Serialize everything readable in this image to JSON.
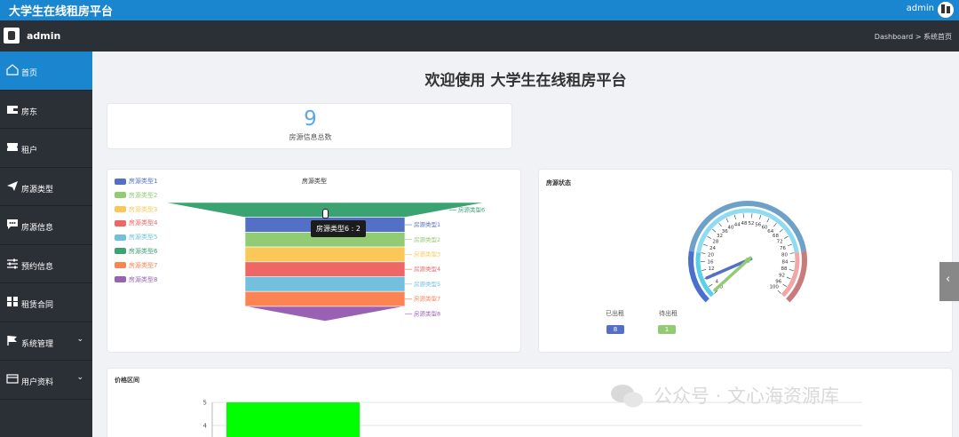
{
  "app": {
    "title": "大学生在线租房平台",
    "user": "admin"
  },
  "topbar2": {
    "name": "admin",
    "breadcrumb": "Dashboard > 系统首页"
  },
  "sidebar": {
    "items": [
      {
        "label": "首页",
        "icon": "home-icon",
        "active": true
      },
      {
        "label": "房东",
        "icon": "wallet-icon"
      },
      {
        "label": "租户",
        "icon": "ticket-icon"
      },
      {
        "label": "房源类型",
        "icon": "send-icon"
      },
      {
        "label": "房源信息",
        "icon": "chat-icon"
      },
      {
        "label": "预约信息",
        "icon": "sliders-icon"
      },
      {
        "label": "租赁合同",
        "icon": "grid-icon"
      },
      {
        "label": "系统管理",
        "icon": "flag-icon",
        "chevron": "⌄"
      },
      {
        "label": "用户资料",
        "icon": "card-icon",
        "chevron": "⌄"
      }
    ]
  },
  "main": {
    "welcome": "欢迎使用 大学生在线租房平台",
    "stat": {
      "value": "9",
      "label": "房源信息总数"
    }
  },
  "funnel": {
    "title": "房源类型",
    "tooltip": "房源类型6 : 2",
    "colors": [
      "#5470c6",
      "#91cc75",
      "#fac858",
      "#ee6666",
      "#73c0de",
      "#3ba272",
      "#fc8452",
      "#9a60b4"
    ]
  },
  "gauge": {
    "title": "房源状态",
    "ticks": [
      "0",
      "4",
      "8",
      "12",
      "16",
      "20",
      "24",
      "28",
      "32",
      "36",
      "40",
      "44",
      "48",
      "52",
      "56",
      "60",
      "64",
      "68",
      "72",
      "76",
      "80",
      "84",
      "88",
      "92",
      "96",
      "100"
    ],
    "rented_label": "已出租",
    "rented_value": "8",
    "available_label": "待出租",
    "available_value": "1"
  },
  "price": {
    "title": "价格区间",
    "yticks": [
      "5",
      "4"
    ]
  },
  "watermark": "公众号 · 文心海资源库",
  "chart_data": [
    {
      "type": "funnel",
      "title": "房源类型",
      "categories": [
        "房源类型1",
        "房源类型2",
        "房源类型3",
        "房源类型4",
        "房源类型5",
        "房源类型6",
        "房源类型7",
        "房源类型8"
      ],
      "values": [
        1,
        1,
        1,
        1,
        1,
        2,
        1,
        1
      ]
    },
    {
      "type": "gauge",
      "title": "房源状态",
      "range": [
        0,
        100
      ],
      "series": [
        {
          "name": "已出租",
          "value": 8
        },
        {
          "name": "待出租",
          "value": 1
        }
      ]
    },
    {
      "type": "bar",
      "title": "价格区间",
      "yticks": [
        5,
        4
      ],
      "bar_color": "#00ff00",
      "values": [
        5
      ]
    }
  ]
}
